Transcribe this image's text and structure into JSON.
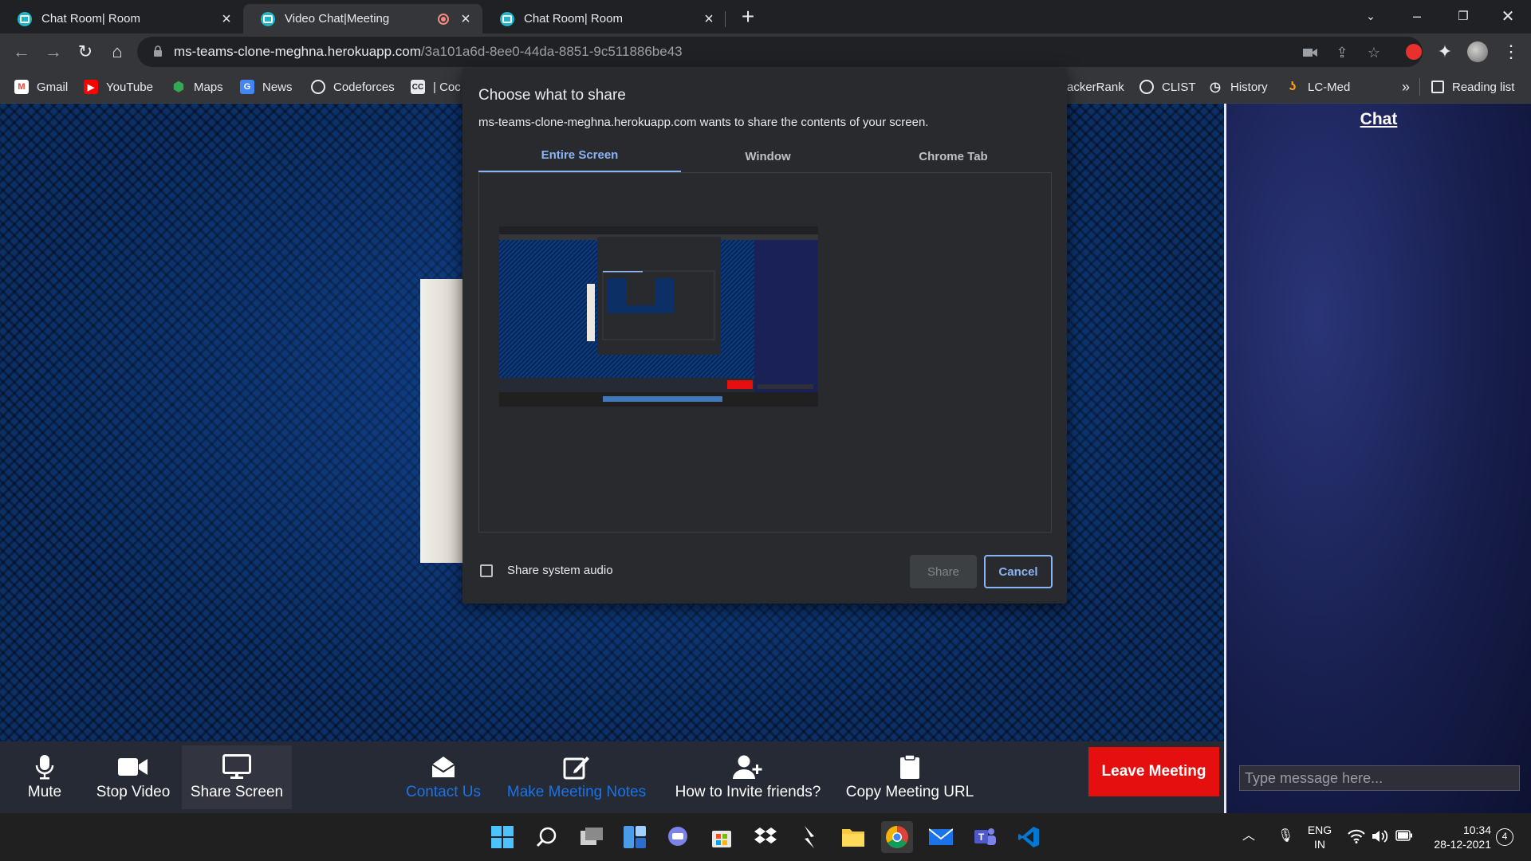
{
  "browser": {
    "tabs": [
      {
        "title": "Chat Room| Room"
      },
      {
        "title": "Video Chat|Meeting"
      },
      {
        "title": "Chat Room| Room"
      }
    ],
    "url_host": "ms-teams-clone-meghna.herokuapp.com",
    "url_path": "/3a101a6d-8ee0-44da-8851-9c511886be43",
    "bookmarks": [
      "Gmail",
      "YouTube",
      "Maps",
      "News",
      "Codeforces",
      "| Coc",
      "ackerRank",
      "CLIST",
      "History",
      "LC-Med"
    ],
    "bookmarks_overflow": "»",
    "reading_list": "Reading list"
  },
  "dialog": {
    "title": "Choose what to share",
    "subtitle": "ms-teams-clone-meghna.herokuapp.com wants to share the contents of your screen.",
    "tabs": [
      "Entire Screen",
      "Window",
      "Chrome Tab"
    ],
    "active_tab": "Entire Screen",
    "checkbox_label": "Share system audio",
    "share_label": "Share",
    "cancel_label": "Cancel"
  },
  "chat": {
    "title": "Chat",
    "placeholder": "Type message here..."
  },
  "controls": {
    "mute": "Mute",
    "stop_video": "Stop Video",
    "share_screen": "Share Screen",
    "contact_us": "Contact Us",
    "meeting_notes": "Make Meeting Notes",
    "invite": "How to Invite friends?",
    "copy_url": "Copy Meeting URL",
    "leave": "Leave Meeting"
  },
  "taskbar": {
    "lang_line1": "ENG",
    "lang_line2": "IN",
    "time": "10:34",
    "date": "28-12-2021",
    "notifications": "4"
  },
  "colors": {
    "leave_button": "#e60f0f",
    "link": "#1a73e8",
    "dialog_accent": "#8ab4f8"
  }
}
